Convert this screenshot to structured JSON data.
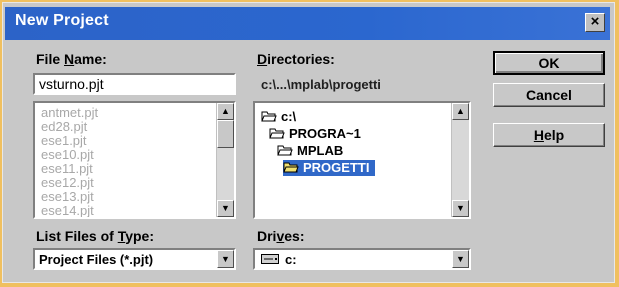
{
  "window": {
    "title": "New Project",
    "close_glyph": "×"
  },
  "file_name": {
    "label_pre": "File ",
    "label_key": "N",
    "label_post": "ame:",
    "value": "vsturno.pjt",
    "files": [
      "antmet.pjt",
      "ed28.pjt",
      "ese1.pjt",
      "ese10.pjt",
      "ese11.pjt",
      "ese12.pjt",
      "ese13.pjt",
      "ese14.pjt"
    ]
  },
  "directories": {
    "label_pre": "",
    "label_key": "D",
    "label_post": "irectories:",
    "current_path": "c:\\...\\mplab\\progetti",
    "tree": [
      {
        "label": "c:\\",
        "icon": "open-folder-icon"
      },
      {
        "label": "PROGRA~1",
        "icon": "open-folder-icon"
      },
      {
        "label": "MPLAB",
        "icon": "open-folder-icon"
      },
      {
        "label": "PROGETTI",
        "icon": "open-folder-icon",
        "selected": true
      }
    ]
  },
  "file_type": {
    "label_pre": "List Files of ",
    "label_key": "T",
    "label_post": "ype:",
    "value": "Project Files (*.pjt)"
  },
  "drives": {
    "label_pre": "Dri",
    "label_key": "v",
    "label_post": "es:",
    "value": "c:",
    "icon": "drive-icon"
  },
  "buttons": {
    "ok": "OK",
    "cancel": "Cancel",
    "help_key": "H",
    "help_post": "elp"
  },
  "colors": {
    "title_bar": "#2b67cf",
    "selection": "#3068c8",
    "face": "#c8c8c8"
  }
}
